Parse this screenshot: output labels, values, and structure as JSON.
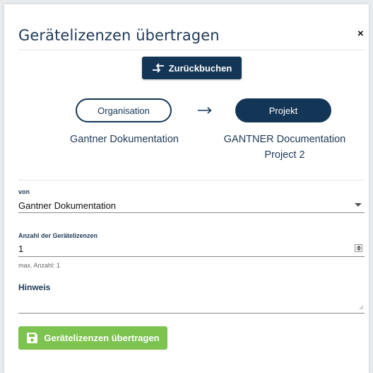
{
  "dialog": {
    "title": "Gerätelizenzen übertragen",
    "close_glyph": "×"
  },
  "transfer": {
    "back_button_label": "Zurückbuchen",
    "back_icon": "swap-arrows-icon",
    "from_pill_label": "Organisation",
    "to_pill_label": "Projekt",
    "arrow_glyph": "⟶",
    "from_entity_name": "Gantner Dokumentation",
    "to_entity_name_line1": "GANTNER Documentation",
    "to_entity_name_line2": "Project 2"
  },
  "form": {
    "von_label": "von",
    "von_value": "Gantner Dokumentation",
    "anzahl_label": "Anzahl der Gerätelizenzen",
    "anzahl_value": "1",
    "max_hint": "max. Anzahl: 1",
    "hinweis_label": "Hinweis",
    "hinweis_value": ""
  },
  "submit": {
    "label": "Gerätelizenzen übertragen",
    "icon": "floppy-disk-icon"
  },
  "colors": {
    "primary": "#143656",
    "success": "#7cc44f",
    "title_text": "#1f3a57"
  }
}
